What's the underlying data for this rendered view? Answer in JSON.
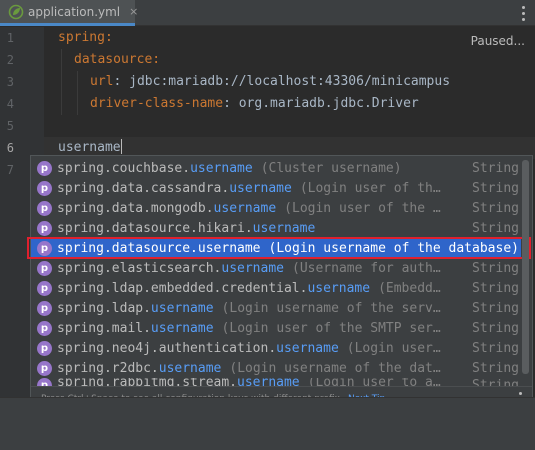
{
  "tab": {
    "label": "application.yml",
    "close": "×",
    "icon": "spring-leaf-icon"
  },
  "editor": {
    "status": "Paused...",
    "lines": [
      {
        "num": "1"
      },
      {
        "num": "2"
      },
      {
        "num": "3"
      },
      {
        "num": "4"
      },
      {
        "num": "5"
      },
      {
        "num": "6"
      },
      {
        "num": "7"
      }
    ],
    "code": {
      "l1_key": "spring:",
      "l2_key": "datasource:",
      "l3_key": "url",
      "l3_sep": ": ",
      "l3_val": "jdbc:mariadb://localhost:43306/minicampus",
      "l4_key": "driver-class-name",
      "l4_sep": ": ",
      "l4_val": "org.mariadb.jdbc.Driver",
      "l6_text": "username"
    }
  },
  "completion": {
    "badge": "p",
    "items": [
      {
        "prefix": "spring.couchbase.",
        "match": "username",
        "desc": "(Cluster username)",
        "type": "String"
      },
      {
        "prefix": "spring.data.cassandra.",
        "match": "username",
        "desc": "(Login user of th…",
        "type": "String"
      },
      {
        "prefix": "spring.data.mongodb.",
        "match": "username",
        "desc": "(Login user of the …",
        "type": "String"
      },
      {
        "prefix": "spring.datasource.hikari.",
        "match": "username",
        "desc": "",
        "type": "String"
      },
      {
        "prefix": "spring.datasource.",
        "match": "username",
        "desc": "(Login username of the database)",
        "type": ""
      },
      {
        "prefix": "spring.elasticsearch.",
        "match": "username",
        "desc": "(Username for auth…",
        "type": "String"
      },
      {
        "prefix": "spring.ldap.embedded.credential.",
        "match": "username",
        "desc": "(Embedd…",
        "type": "String"
      },
      {
        "prefix": "spring.ldap.",
        "match": "username",
        "desc": "(Login username of the serv…",
        "type": "String"
      },
      {
        "prefix": "spring.mail.",
        "match": "username",
        "desc": "(Login user of the SMTP ser…",
        "type": "String"
      },
      {
        "prefix": "spring.neo4j.authentication.",
        "match": "username",
        "desc": "(Login user…",
        "type": "String"
      },
      {
        "prefix": "spring.r2dbc.",
        "match": "username",
        "desc": "(Login username of the dat…",
        "type": "String"
      },
      {
        "prefix": "spring.rabbitmq.stream.",
        "match": "username",
        "desc": "(Login user to a…",
        "type": "String"
      }
    ],
    "selected_index": 4,
    "footer_text": "Press Ctrl+Space to see all configuration keys with different prefix",
    "next_tip": "Next Tip"
  },
  "colors": {
    "accent": "#2f65ca",
    "highlight_box": "#e0202e",
    "yaml_key": "#cc7832",
    "match": "#589df6"
  }
}
